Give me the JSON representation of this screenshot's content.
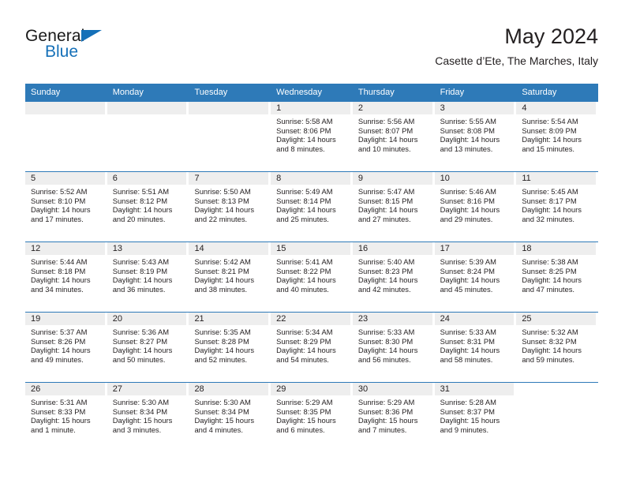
{
  "logo": {
    "text_top": "General",
    "text_bottom": "Blue",
    "brand_color": "#1570b8"
  },
  "header": {
    "title": "May 2024",
    "subtitle": "Casette d’Ete, The Marches, Italy",
    "accent_color": "#2e7ab8"
  },
  "weekdays": [
    "Sunday",
    "Monday",
    "Tuesday",
    "Wednesday",
    "Thursday",
    "Friday",
    "Saturday"
  ],
  "weeks": [
    [
      {
        "day": "",
        "sunrise": "",
        "sunset": "",
        "daylight1": "",
        "daylight2": "",
        "empty": true
      },
      {
        "day": "",
        "sunrise": "",
        "sunset": "",
        "daylight1": "",
        "daylight2": "",
        "empty": true
      },
      {
        "day": "",
        "sunrise": "",
        "sunset": "",
        "daylight1": "",
        "daylight2": "",
        "empty": true
      },
      {
        "day": "1",
        "sunrise": "Sunrise: 5:58 AM",
        "sunset": "Sunset: 8:06 PM",
        "daylight1": "Daylight: 14 hours",
        "daylight2": "and 8 minutes."
      },
      {
        "day": "2",
        "sunrise": "Sunrise: 5:56 AM",
        "sunset": "Sunset: 8:07 PM",
        "daylight1": "Daylight: 14 hours",
        "daylight2": "and 10 minutes."
      },
      {
        "day": "3",
        "sunrise": "Sunrise: 5:55 AM",
        "sunset": "Sunset: 8:08 PM",
        "daylight1": "Daylight: 14 hours",
        "daylight2": "and 13 minutes."
      },
      {
        "day": "4",
        "sunrise": "Sunrise: 5:54 AM",
        "sunset": "Sunset: 8:09 PM",
        "daylight1": "Daylight: 14 hours",
        "daylight2": "and 15 minutes."
      }
    ],
    [
      {
        "day": "5",
        "sunrise": "Sunrise: 5:52 AM",
        "sunset": "Sunset: 8:10 PM",
        "daylight1": "Daylight: 14 hours",
        "daylight2": "and 17 minutes."
      },
      {
        "day": "6",
        "sunrise": "Sunrise: 5:51 AM",
        "sunset": "Sunset: 8:12 PM",
        "daylight1": "Daylight: 14 hours",
        "daylight2": "and 20 minutes."
      },
      {
        "day": "7",
        "sunrise": "Sunrise: 5:50 AM",
        "sunset": "Sunset: 8:13 PM",
        "daylight1": "Daylight: 14 hours",
        "daylight2": "and 22 minutes."
      },
      {
        "day": "8",
        "sunrise": "Sunrise: 5:49 AM",
        "sunset": "Sunset: 8:14 PM",
        "daylight1": "Daylight: 14 hours",
        "daylight2": "and 25 minutes."
      },
      {
        "day": "9",
        "sunrise": "Sunrise: 5:47 AM",
        "sunset": "Sunset: 8:15 PM",
        "daylight1": "Daylight: 14 hours",
        "daylight2": "and 27 minutes."
      },
      {
        "day": "10",
        "sunrise": "Sunrise: 5:46 AM",
        "sunset": "Sunset: 8:16 PM",
        "daylight1": "Daylight: 14 hours",
        "daylight2": "and 29 minutes."
      },
      {
        "day": "11",
        "sunrise": "Sunrise: 5:45 AM",
        "sunset": "Sunset: 8:17 PM",
        "daylight1": "Daylight: 14 hours",
        "daylight2": "and 32 minutes."
      }
    ],
    [
      {
        "day": "12",
        "sunrise": "Sunrise: 5:44 AM",
        "sunset": "Sunset: 8:18 PM",
        "daylight1": "Daylight: 14 hours",
        "daylight2": "and 34 minutes."
      },
      {
        "day": "13",
        "sunrise": "Sunrise: 5:43 AM",
        "sunset": "Sunset: 8:19 PM",
        "daylight1": "Daylight: 14 hours",
        "daylight2": "and 36 minutes."
      },
      {
        "day": "14",
        "sunrise": "Sunrise: 5:42 AM",
        "sunset": "Sunset: 8:21 PM",
        "daylight1": "Daylight: 14 hours",
        "daylight2": "and 38 minutes."
      },
      {
        "day": "15",
        "sunrise": "Sunrise: 5:41 AM",
        "sunset": "Sunset: 8:22 PM",
        "daylight1": "Daylight: 14 hours",
        "daylight2": "and 40 minutes."
      },
      {
        "day": "16",
        "sunrise": "Sunrise: 5:40 AM",
        "sunset": "Sunset: 8:23 PM",
        "daylight1": "Daylight: 14 hours",
        "daylight2": "and 42 minutes."
      },
      {
        "day": "17",
        "sunrise": "Sunrise: 5:39 AM",
        "sunset": "Sunset: 8:24 PM",
        "daylight1": "Daylight: 14 hours",
        "daylight2": "and 45 minutes."
      },
      {
        "day": "18",
        "sunrise": "Sunrise: 5:38 AM",
        "sunset": "Sunset: 8:25 PM",
        "daylight1": "Daylight: 14 hours",
        "daylight2": "and 47 minutes."
      }
    ],
    [
      {
        "day": "19",
        "sunrise": "Sunrise: 5:37 AM",
        "sunset": "Sunset: 8:26 PM",
        "daylight1": "Daylight: 14 hours",
        "daylight2": "and 49 minutes."
      },
      {
        "day": "20",
        "sunrise": "Sunrise: 5:36 AM",
        "sunset": "Sunset: 8:27 PM",
        "daylight1": "Daylight: 14 hours",
        "daylight2": "and 50 minutes."
      },
      {
        "day": "21",
        "sunrise": "Sunrise: 5:35 AM",
        "sunset": "Sunset: 8:28 PM",
        "daylight1": "Daylight: 14 hours",
        "daylight2": "and 52 minutes."
      },
      {
        "day": "22",
        "sunrise": "Sunrise: 5:34 AM",
        "sunset": "Sunset: 8:29 PM",
        "daylight1": "Daylight: 14 hours",
        "daylight2": "and 54 minutes."
      },
      {
        "day": "23",
        "sunrise": "Sunrise: 5:33 AM",
        "sunset": "Sunset: 8:30 PM",
        "daylight1": "Daylight: 14 hours",
        "daylight2": "and 56 minutes."
      },
      {
        "day": "24",
        "sunrise": "Sunrise: 5:33 AM",
        "sunset": "Sunset: 8:31 PM",
        "daylight1": "Daylight: 14 hours",
        "daylight2": "and 58 minutes."
      },
      {
        "day": "25",
        "sunrise": "Sunrise: 5:32 AM",
        "sunset": "Sunset: 8:32 PM",
        "daylight1": "Daylight: 14 hours",
        "daylight2": "and 59 minutes."
      }
    ],
    [
      {
        "day": "26",
        "sunrise": "Sunrise: 5:31 AM",
        "sunset": "Sunset: 8:33 PM",
        "daylight1": "Daylight: 15 hours",
        "daylight2": "and 1 minute."
      },
      {
        "day": "27",
        "sunrise": "Sunrise: 5:30 AM",
        "sunset": "Sunset: 8:34 PM",
        "daylight1": "Daylight: 15 hours",
        "daylight2": "and 3 minutes."
      },
      {
        "day": "28",
        "sunrise": "Sunrise: 5:30 AM",
        "sunset": "Sunset: 8:34 PM",
        "daylight1": "Daylight: 15 hours",
        "daylight2": "and 4 minutes."
      },
      {
        "day": "29",
        "sunrise": "Sunrise: 5:29 AM",
        "sunset": "Sunset: 8:35 PM",
        "daylight1": "Daylight: 15 hours",
        "daylight2": "and 6 minutes."
      },
      {
        "day": "30",
        "sunrise": "Sunrise: 5:29 AM",
        "sunset": "Sunset: 8:36 PM",
        "daylight1": "Daylight: 15 hours",
        "daylight2": "and 7 minutes."
      },
      {
        "day": "31",
        "sunrise": "Sunrise: 5:28 AM",
        "sunset": "Sunset: 8:37 PM",
        "daylight1": "Daylight: 15 hours",
        "daylight2": "and 9 minutes."
      },
      {
        "day": "",
        "sunrise": "",
        "sunset": "",
        "daylight1": "",
        "daylight2": "",
        "empty": true,
        "blank": true
      }
    ]
  ]
}
